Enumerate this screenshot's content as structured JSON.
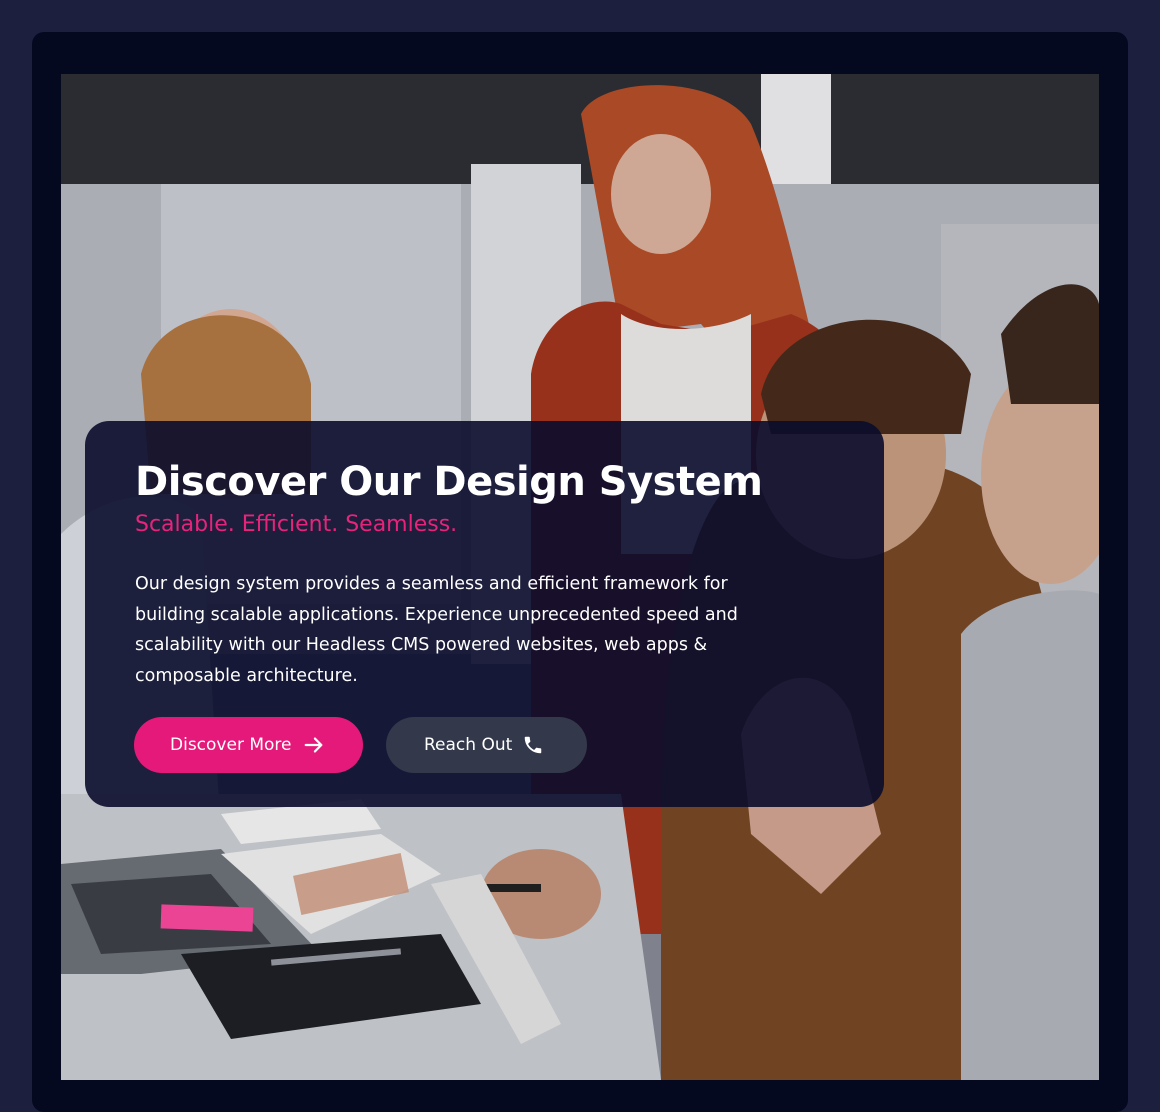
{
  "hero": {
    "title": "Discover Our Design System",
    "subtitle": "Scalable. Efficient. Seamless.",
    "description": "Our design system provides a seamless and efficient framework for building scalable applications. Experience unprecedented speed and scalability with our Headless CMS powered websites, web apps & composable architecture.",
    "primary_button": {
      "label": "Discover More",
      "icon": "arrow-right-icon"
    },
    "secondary_button": {
      "label": "Reach Out",
      "icon": "phone-icon"
    }
  },
  "colors": {
    "page_background": "#1d1f3e",
    "frame_background": "#05091f",
    "card_background": "#0a0c2c",
    "accent": "#e5197a",
    "secondary_button": "#33384b",
    "text": "#ffffff"
  }
}
